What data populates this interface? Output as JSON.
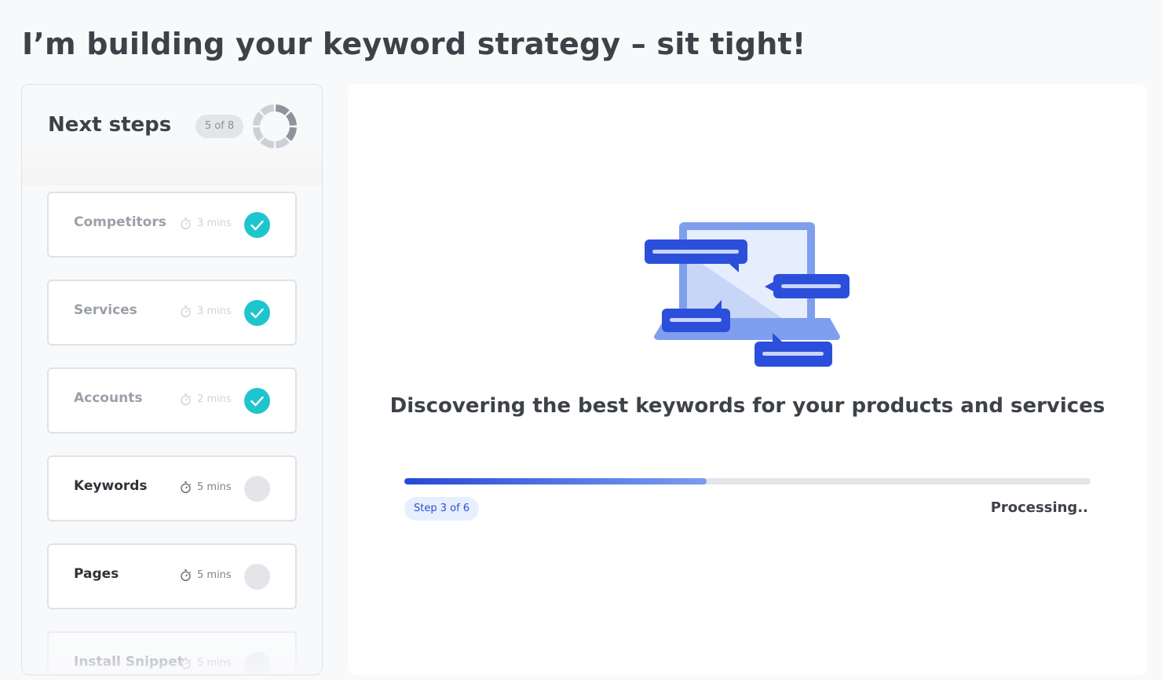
{
  "page": {
    "title": "I’m building your keyword strategy – sit tight!"
  },
  "steps_panel": {
    "title": "Next steps",
    "count_label": "5 of 8",
    "progress": {
      "completed": 3,
      "total": 8
    },
    "items": [
      {
        "label": "Competitors",
        "time": "3 mins",
        "status": "complete"
      },
      {
        "label": "Services",
        "time": "3 mins",
        "status": "complete"
      },
      {
        "label": "Accounts",
        "time": "2 mins",
        "status": "complete"
      },
      {
        "label": "Keywords",
        "time": "5 mins",
        "status": "pending"
      },
      {
        "label": "Pages",
        "time": "5 mins",
        "status": "pending"
      },
      {
        "label": "Install Snippet",
        "time": "5 mins",
        "status": "pending"
      }
    ]
  },
  "main": {
    "headline": "Discovering the best keywords for your products and services",
    "progress_fraction": 0.44,
    "step_badge": "Step 3 of 6",
    "status_text": "Processing.."
  },
  "colors": {
    "accent_blue": "#2748d6",
    "complete_teal": "#1fc5cc",
    "pending_gray": "#e3e5e9"
  },
  "icons": {
    "timer": "stopwatch-icon",
    "check": "check-icon",
    "progress": "segmented-ring-icon"
  }
}
